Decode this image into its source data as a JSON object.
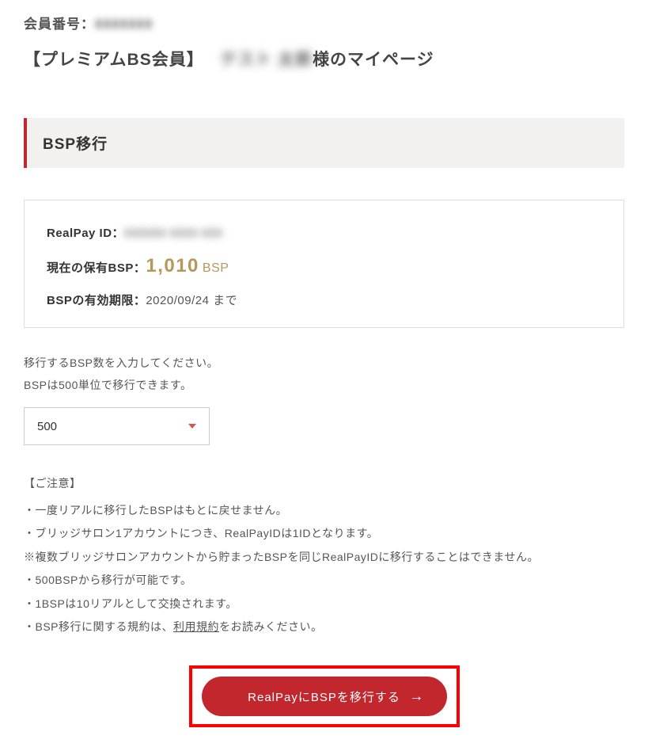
{
  "member": {
    "number_label": "会員番号：",
    "number_value": "0000000",
    "tier": "【プレミアムBS会員】",
    "name": "テスト 太郎",
    "suffix": "様のマイページ"
  },
  "section": {
    "title": "BSP移行"
  },
  "realpay": {
    "label": "RealPay ID：",
    "value": "000000 0000 000"
  },
  "bsp": {
    "current_label": "現在の保有BSP：",
    "value": "1,010",
    "unit": "BSP",
    "expiry_label": "BSPの有効期限：",
    "expiry_value": "2020/09/24 まで"
  },
  "transfer": {
    "instruction_line1": "移行するBSP数を入力してください。",
    "instruction_line2": "BSPは500単位で移行できます。",
    "selected_amount": "500"
  },
  "notice": {
    "heading": "【ご注意】",
    "line1": "・一度リアルに移行したBSPはもとに戻せません。",
    "line2": "・ブリッジサロン1アカウントにつき、RealPayIDは1IDとなります。",
    "line3": "※複数ブリッジサロンアカウントから貯まったBSPを同じRealPayIDに移行することはできません。",
    "line4": "・500BSPから移行が可能です。",
    "line5": "・1BSPは10リアルとして交換されます。",
    "line6_pre": "・BSP移行に関する規約は、",
    "line6_link": "利用規約",
    "line6_post": "をお読みください。"
  },
  "button": {
    "label": "RealPayにBSPを移行する"
  }
}
